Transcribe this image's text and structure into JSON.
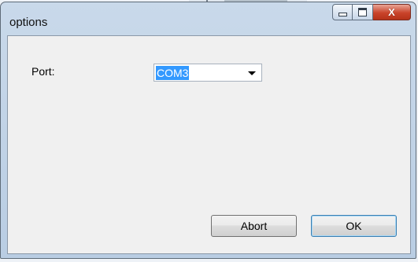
{
  "window": {
    "title": "options",
    "caption_buttons": {
      "minimize_icon": "minimize-icon",
      "maximize_icon": "maximize-icon",
      "close_icon": "close-icon",
      "close_glyph": "X"
    }
  },
  "form": {
    "port_label": "Port:",
    "port_value": "COM3"
  },
  "buttons": {
    "abort_label": "Abort",
    "ok_label": "OK"
  }
}
